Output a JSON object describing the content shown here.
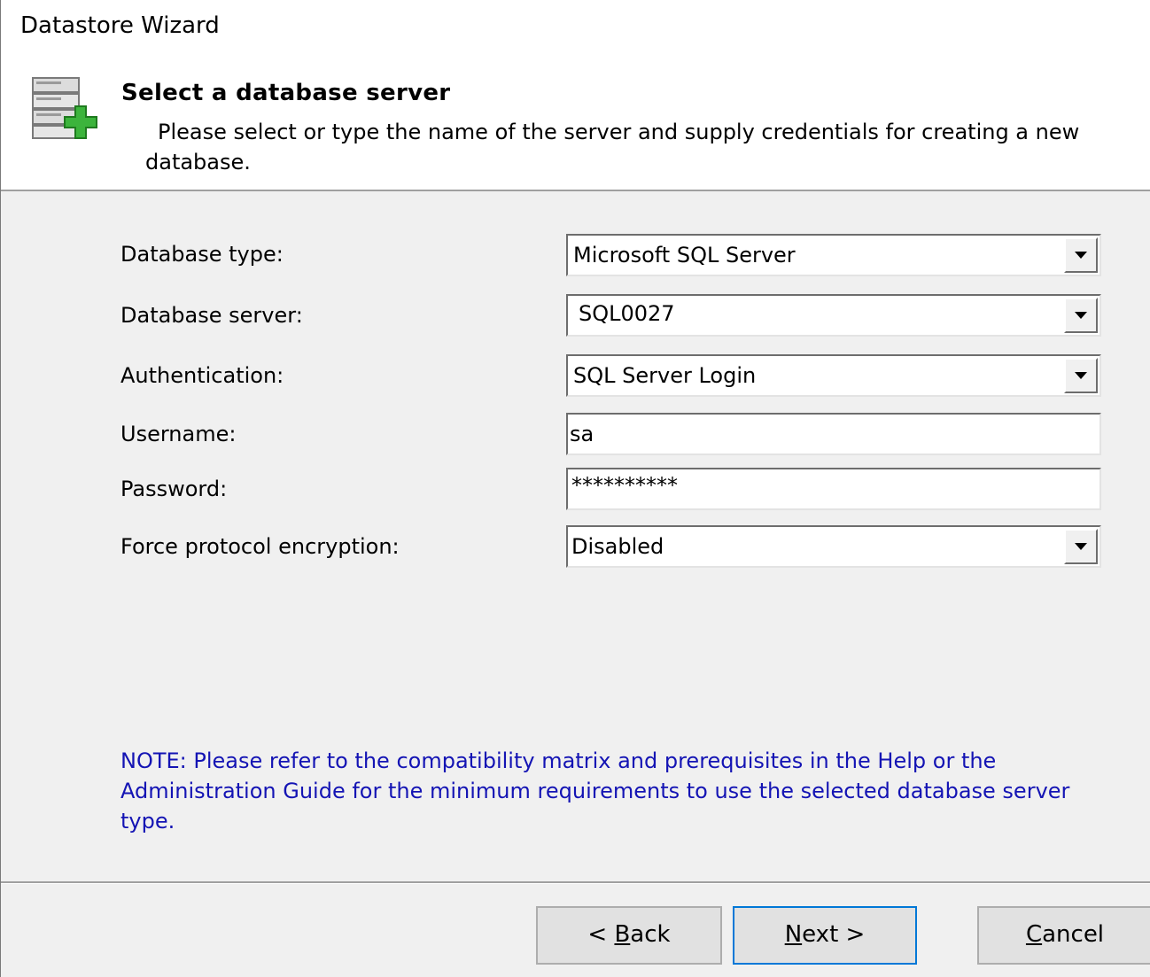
{
  "window": {
    "title": "Datastore Wizard"
  },
  "header": {
    "title": "Select a database server",
    "description": "Please select or type the name of the server and supply credentials for creating a new database.",
    "icon": "database-add-icon"
  },
  "form": {
    "database_type": {
      "label": "Database type:",
      "value": "Microsoft SQL Server"
    },
    "database_server": {
      "label": "Database server:",
      "value": "SQL0027"
    },
    "authentication": {
      "label": "Authentication:",
      "value": "SQL Server Login"
    },
    "username": {
      "label": "Username:",
      "value": "sa"
    },
    "password": {
      "label": "Password:",
      "value": "**********"
    },
    "force_encryption": {
      "label": "Force protocol encryption:",
      "value": "Disabled"
    }
  },
  "note": "NOTE: Please refer to the compatibility matrix and prerequisites in the Help or the Administration Guide for the minimum requirements to use the selected database server type.",
  "buttons": {
    "back": {
      "prefix": "< ",
      "mnemonic": "B",
      "rest": "ack"
    },
    "next": {
      "mnemonic": "N",
      "rest": "ext >"
    },
    "cancel": {
      "mnemonic": "C",
      "rest": "ancel"
    }
  },
  "colors": {
    "note_text": "#1414b4",
    "default_button_border": "#0078d7",
    "icon_plus_green": "#3cb43c"
  }
}
